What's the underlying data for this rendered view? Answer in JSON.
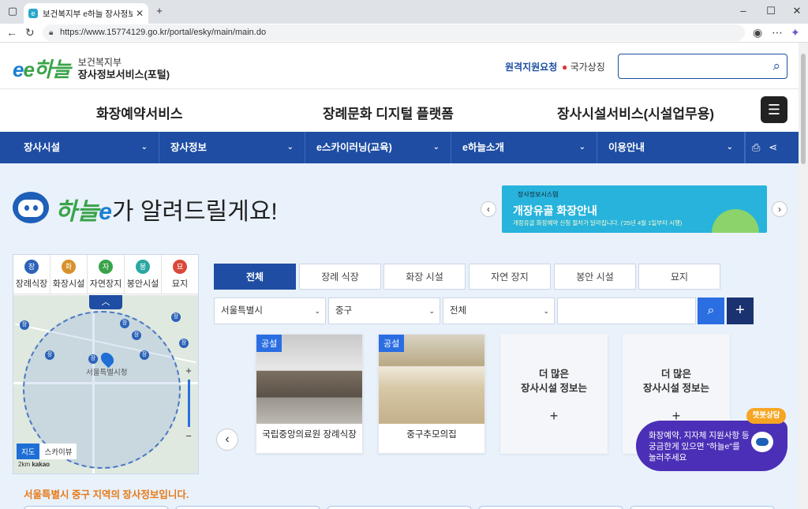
{
  "browser": {
    "tab_title": "보건복지부 e하늘 장사정보서비스",
    "url": "https://www.15774129.go.kr/portal/esky/main/main.do"
  },
  "header": {
    "logo_mark": "e하늘",
    "logo_line1": "보건복지부",
    "logo_line2": "장사정보서비스(포털)",
    "remote_support": "원격지원요청",
    "national_symbol": "국가상징",
    "search_placeholder": ""
  },
  "main_nav": [
    "화장예약서비스",
    "장례문화 디지털 플랫폼",
    "장사시설서비스(시설업무용)"
  ],
  "gnb": [
    "장사시설",
    "장사정보",
    "e스카이러닝(교육)",
    "e하늘소개",
    "이용안내"
  ],
  "hero": {
    "heading_brand_a": "하늘",
    "heading_brand_b": "e",
    "heading_text": "가 알려드릴게요!"
  },
  "banner": {
    "small": "장사정보시스템",
    "title": "개장유골 화장안내",
    "desc": "개장유골 화장예약 신청 절차가 달라집니다. ('25년 4월 1일부터 시행)"
  },
  "map_tabs": [
    {
      "icon": "장",
      "label": "장례식장",
      "color": "#2d62b8"
    },
    {
      "icon": "화",
      "label": "화장시설",
      "color": "#d9902a"
    },
    {
      "icon": "자",
      "label": "자연장지",
      "color": "#3aa34a"
    },
    {
      "icon": "봉",
      "label": "봉안시설",
      "color": "#2aa7a0"
    },
    {
      "icon": "묘",
      "label": "묘지",
      "color": "#d9483b"
    }
  ],
  "map": {
    "city_label": "서울특별시청",
    "type_map": "지도",
    "type_sky": "스카이뷰",
    "scale": "2km",
    "provider": "kakao",
    "pin_label": "장"
  },
  "filter_tabs": [
    "전체",
    "장례 식장",
    "화장 시설",
    "자연 장지",
    "봉안 시설",
    "묘지"
  ],
  "filters": {
    "city": "서울특별시",
    "district": "중구",
    "type": "전체"
  },
  "cards": [
    {
      "badge": "공설",
      "name": "국립중앙의료원 장례식장"
    },
    {
      "badge": "공설",
      "name": "중구추모의집"
    }
  ],
  "more_card": {
    "line1": "더 많은",
    "line2": "장사시설 정보는",
    "plus": "+"
  },
  "region_title": "서울특별시 중구 지역의 장사정보입니다.",
  "chatbot": {
    "tag": "챗봇상담",
    "line1": "화장예약, 지자체 지원사항 등",
    "line2": "궁금한게 있으면 \"하늘e\"를",
    "line3": "눌러주세요"
  }
}
